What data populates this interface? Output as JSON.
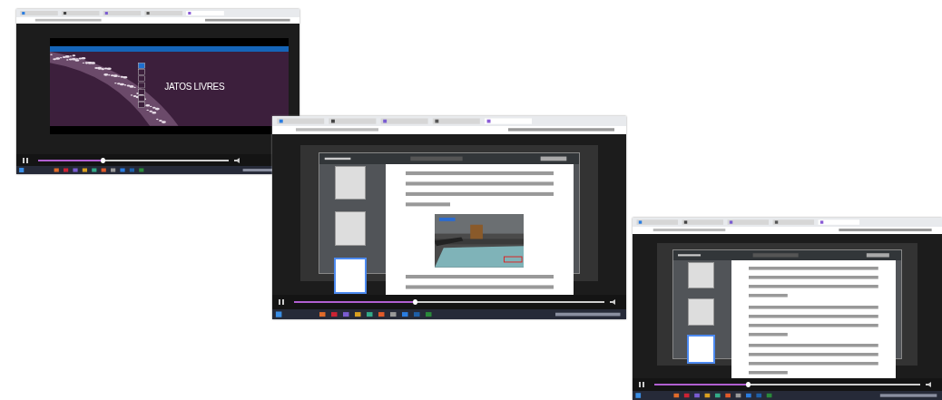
{
  "screenshots": [
    {
      "kind": "video",
      "slide_title": "JATOS LIVRES",
      "player": {
        "level": 0.34
      }
    },
    {
      "kind": "pdf",
      "player": {
        "level": 0.39
      }
    },
    {
      "kind": "pdf",
      "player": {
        "level": 0.35
      }
    }
  ]
}
